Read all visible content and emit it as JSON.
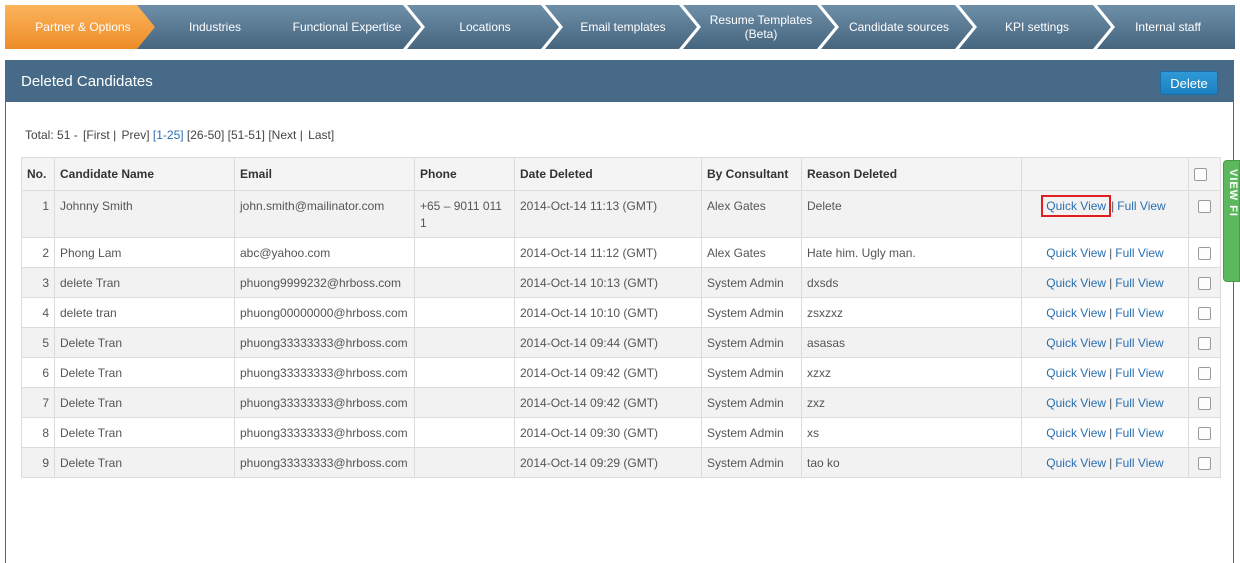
{
  "steps": [
    {
      "label": "Partner & Options",
      "active": true
    },
    {
      "label": "Industries"
    },
    {
      "label": "Functional Expertise"
    },
    {
      "label": "Locations"
    },
    {
      "label": "Email templates"
    },
    {
      "label": "Resume Templates (Beta)"
    },
    {
      "label": "Candidate sources"
    },
    {
      "label": "KPI settings"
    },
    {
      "label": "Internal staff"
    }
  ],
  "panel": {
    "title": "Deleted Candidates",
    "delete_label": "Delete"
  },
  "pager": {
    "total": "Total: 51  -",
    "first": "[First",
    "sep1": "|",
    "prev": "Prev]",
    "range1": "[1-25]",
    "range2": "[26-50]",
    "range3": "[51-51]",
    "next": "[Next",
    "sep2": "|",
    "last": "Last]"
  },
  "table": {
    "headers": {
      "no": "No.",
      "name": "Candidate Name",
      "email": "Email",
      "phone": "Phone",
      "date": "Date Deleted",
      "consultant": "By Consultant",
      "reason": "Reason Deleted"
    },
    "quick_view": "Quick View",
    "full_view": "Full View",
    "link_sep": "|",
    "rows": [
      {
        "no": "1",
        "name": "Johnny Smith",
        "email": "john.smith@mailinator.com",
        "phone": "+65 – 9011 011 1",
        "date": "2014-Oct-14 11:13 (GMT)",
        "consultant": "Alex Gates",
        "reason": "Delete"
      },
      {
        "no": "2",
        "name": "Phong Lam",
        "email": "abc@yahoo.com",
        "phone": "",
        "date": "2014-Oct-14 11:12 (GMT)",
        "consultant": "Alex Gates",
        "reason": "Hate him. Ugly man."
      },
      {
        "no": "3",
        "name": "delete Tran",
        "email": "phuong9999232@hrboss.com",
        "phone": "",
        "date": "2014-Oct-14 10:13 (GMT)",
        "consultant": "System Admin",
        "reason": "dxsds"
      },
      {
        "no": "4",
        "name": "delete tran",
        "email": "phuong00000000@hrboss.com",
        "phone": "",
        "date": "2014-Oct-14 10:10 (GMT)",
        "consultant": "System Admin",
        "reason": "zsxzxz"
      },
      {
        "no": "5",
        "name": "Delete Tran",
        "email": "phuong33333333@hrboss.com",
        "phone": "",
        "date": "2014-Oct-14 09:44 (GMT)",
        "consultant": "System Admin",
        "reason": "asasas"
      },
      {
        "no": "6",
        "name": "Delete Tran",
        "email": "phuong33333333@hrboss.com",
        "phone": "",
        "date": "2014-Oct-14 09:42 (GMT)",
        "consultant": "System Admin",
        "reason": "xzxz"
      },
      {
        "no": "7",
        "name": "Delete Tran",
        "email": "phuong33333333@hrboss.com",
        "phone": "",
        "date": "2014-Oct-14 09:42 (GMT)",
        "consultant": "System Admin",
        "reason": "zxz"
      },
      {
        "no": "8",
        "name": "Delete Tran",
        "email": "phuong33333333@hrboss.com",
        "phone": "",
        "date": "2014-Oct-14 09:30 (GMT)",
        "consultant": "System Admin",
        "reason": "xs"
      },
      {
        "no": "9",
        "name": "Delete Tran",
        "email": "phuong33333333@hrboss.com",
        "phone": "",
        "date": "2014-Oct-14 09:29 (GMT)",
        "consultant": "System Admin",
        "reason": "tao ko"
      }
    ]
  },
  "sidetab": {
    "label": "VIEW FI"
  },
  "colors": {
    "accent": "#466a87",
    "active_step": "#f29a3a",
    "link": "#2a6fb0",
    "highlight": "#e02020"
  }
}
